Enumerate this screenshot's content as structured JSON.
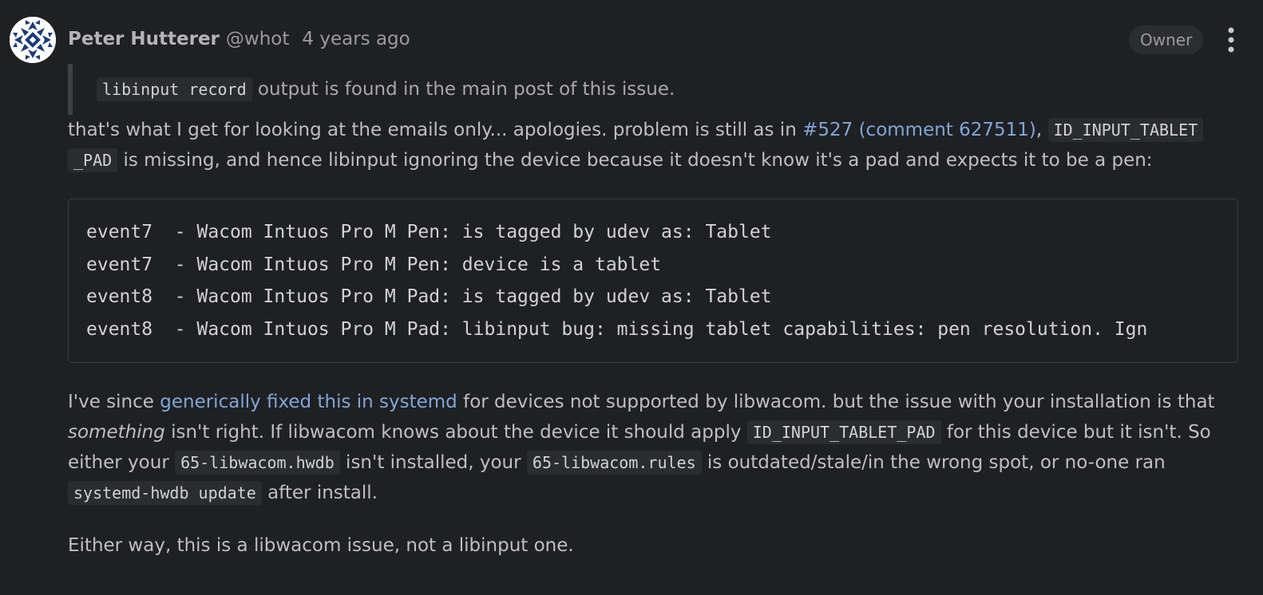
{
  "author": {
    "name": "Peter Hutterer",
    "handle": "@whot",
    "time": "4 years ago",
    "role_badge": "Owner"
  },
  "icons": {
    "avatar": "avatar-image",
    "menu": "kebab-menu-icon"
  },
  "quote": {
    "code": "libinput record",
    "text": " output is found in the main post of this issue."
  },
  "paragraph1": {
    "text_a": "that's what I get for looking at the emails only... apologies. problem is still as in ",
    "link": "#527 (comment 627511)",
    "text_b": ", ",
    "code_a": "ID_INPUT_TABLET",
    "code_b": "_PAD",
    "text_c": " is missing, and hence libinput ignoring the device because it doesn't know it's a pad and expects it to be a pen:"
  },
  "code_block": [
    "event7  - Wacom Intuos Pro M Pen: is tagged by udev as: Tablet",
    "event7  - Wacom Intuos Pro M Pen: device is a tablet",
    "event8  - Wacom Intuos Pro M Pad: is tagged by udev as: Tablet",
    "event8  - Wacom Intuos Pro M Pad: libinput bug: missing tablet capabilities: pen resolution. Ign"
  ],
  "paragraph2": {
    "t1": "I've since ",
    "link": "generically fixed this in systemd",
    "t2": " for devices not supported by libwacom. but the issue with your installation is that ",
    "em": "something",
    "t3": " isn't right. If libwacom knows about the device it should apply ",
    "code1": "ID_INPUT_TABLET_PAD",
    "t4": " for this device but it isn't. So either your ",
    "code2": "65-libwacom.hwdb",
    "t5": " isn't installed, your ",
    "code3": "65-libwacom.rules",
    "t6": " is outdated/stale/in the wrong spot, or no-one ran ",
    "code4": "systemd-hwdb update",
    "t7": " after install."
  },
  "paragraph3": {
    "text": "Either way, this is a libwacom issue, not a libinput one."
  },
  "colors": {
    "background": "#1f2022",
    "link": "#7fa6d8",
    "avatar_blue": "#1b3a7a"
  }
}
